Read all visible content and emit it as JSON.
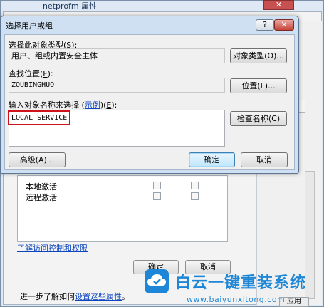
{
  "background_window": {
    "title": "netprofm 属性",
    "close_glyph": "✕",
    "permission_rows": [
      {
        "label": "本地激活"
      },
      {
        "label": "远程激活"
      }
    ],
    "link_text": "了解访问控制和权限",
    "ok_label": "确定",
    "cancel_label": "取消",
    "bottom_text": "进一步了解如何",
    "bottom_link": "设置这些属性",
    "bottom_suffix": "。",
    "apply_label": "应用"
  },
  "dialog": {
    "title": "选择用户或组",
    "help_glyph": "?",
    "close_glyph": "✕",
    "object_type_label": "选择此对象类型",
    "object_type_hotkey": "S",
    "object_type_value": "用户、组或内置安全主体",
    "object_type_button": "对象类型(O)...",
    "location_label": "查找位置",
    "location_hotkey": "F",
    "location_value": "ZOUBINGHUO",
    "location_button": "位置(L)...",
    "names_label_prefix": "输入对象名称来选择 (",
    "names_example_link": "示例",
    "names_label_suffix": ")",
    "names_hotkey": "E",
    "names_value": "LOCAL SERVICE",
    "check_names_button": "检查名称(C)",
    "advanced_button": "高级(A)...",
    "ok_button": "确定",
    "cancel_button": "取消"
  },
  "watermark": {
    "title": "白云一键重装系统",
    "url": "www.baiyunxitong.com"
  },
  "colors": {
    "highlight_box": "#d0121b",
    "link": "#0b45c0",
    "watermark": "#1d86d6"
  }
}
